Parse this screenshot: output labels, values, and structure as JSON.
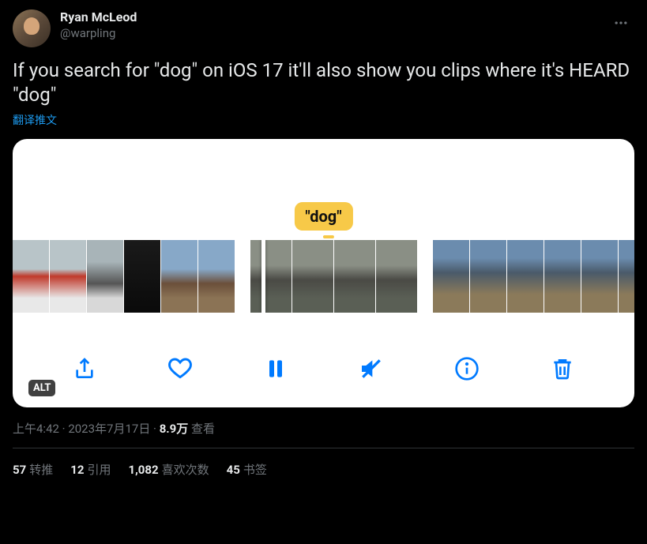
{
  "author": {
    "display_name": "Ryan McLeod",
    "handle": "@warpling"
  },
  "tweet_text": "If you search for \"dog\" on iOS 17 it'll also show you clips where it's HEARD \"dog\"",
  "translate_label": "翻译推文",
  "media": {
    "pill_text": "\"dog\"",
    "alt_badge": "ALT"
  },
  "meta": {
    "time": "上午4:42",
    "date": "2023年7月17日",
    "views_number": "8.9万",
    "views_label": "查看",
    "separator": " · "
  },
  "engagement": {
    "retweets": {
      "count": "57",
      "label": "转推"
    },
    "quotes": {
      "count": "12",
      "label": "引用"
    },
    "likes": {
      "count": "1,082",
      "label": "喜欢次数"
    },
    "bookmarks": {
      "count": "45",
      "label": "书签"
    }
  }
}
